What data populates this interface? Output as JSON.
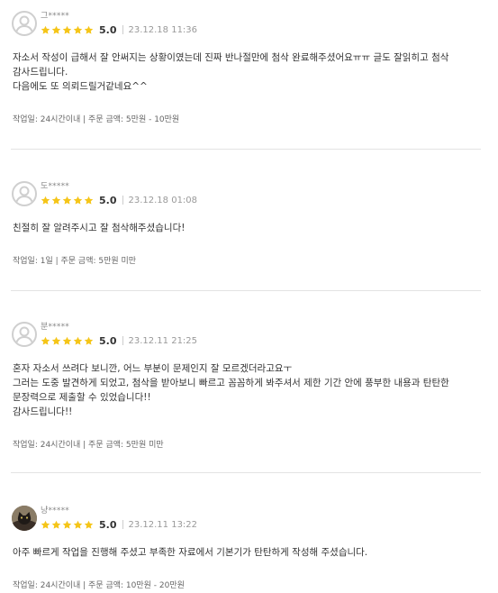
{
  "colors": {
    "star": "#f5c518",
    "divider": "#e3e3e3",
    "text": "#333333",
    "muted": "#999999"
  },
  "reviews": [
    {
      "username": "그*****",
      "avatar": "default-avatar",
      "rating": "5.0",
      "stars": 5,
      "date": "23.12.18 11:36",
      "lines": [
        "자소서 작성이 급해서 잘 안써지는 상황이였는데  진짜 반나절만에 첨삭 완료해주셨어요ㅠㅠ 글도 잘읽히고 첨삭 감사드립니다.",
        "다음에도 또 의뢰드릴거같네요^^"
      ],
      "info": "작업일: 24시간이내 | 주문 금액: 5만원 - 10만원"
    },
    {
      "username": "도*****",
      "avatar": "default-avatar",
      "rating": "5.0",
      "stars": 5,
      "date": "23.12.18 01:08",
      "lines": [
        "친절히 잘 알려주시고 잘 첨삭해주셨습니다!"
      ],
      "info": "작업일: 1일 | 주문 금액: 5만원 미만"
    },
    {
      "username": "분*****",
      "avatar": "default-avatar",
      "rating": "5.0",
      "stars": 5,
      "date": "23.12.11 21:25",
      "lines": [
        "혼자 자소서 쓰려다 보니깐, 어느 부분이 문제인지 잘 모르겠더라고요ㅜ",
        "그러는 도중 발견하게 되었고, 첨삭을 받아보니 빠르고 꼼꼼하게 봐주셔서 제한 기간 안에 풍부한 내용과 탄탄한 문장력으로 제출할 수 있었습니다!!",
        "감사드립니다!!"
      ],
      "info": "작업일: 24시간이내 | 주문 금액: 5만원 미만"
    },
    {
      "username": "냥*****",
      "avatar": "cat-photo-avatar",
      "rating": "5.0",
      "stars": 5,
      "date": "23.12.11 13:22",
      "lines": [
        "아주 빠르게 작업을 진행해 주셨고 부족한 자료에서 기본기가 탄탄하게 작성해 주셨습니다."
      ],
      "info": "작업일: 24시간이내 | 주문 금액: 10만원 - 20만원"
    }
  ]
}
